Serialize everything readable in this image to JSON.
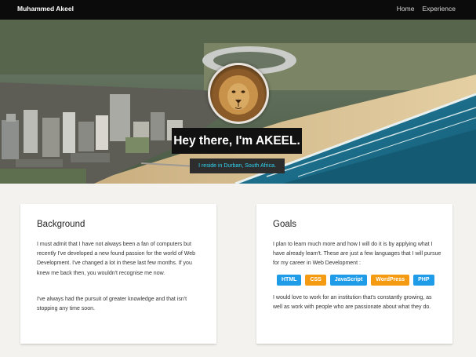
{
  "navbar": {
    "brand": "Muhammed Akeel",
    "links": [
      "Home",
      "Experience"
    ]
  },
  "hero": {
    "headline": "Hey there, I'm AKEEL.",
    "subline": "I reside in Durban, South Africa."
  },
  "background_card": {
    "title": "Background",
    "paragraph_1": "I must admit that I have not always been a fan of computers but recently I've developed a new found passion for the world of Web Development. I've changed a lot in these last few months. If you knew me back then, you wouldn't recognise me now.",
    "paragraph_2": "I've always had the pursuit of greater knowledge and that isn't stopping any time soon."
  },
  "goals_card": {
    "title": "Goals",
    "paragraph_1": "I plan to learn much more and how I will do it is by applying what I have already learn't. These are just a few languages that I will pursue for my career in Web Development :",
    "tags": [
      {
        "label": "HTML",
        "color": "#1e9ce8"
      },
      {
        "label": "CSS",
        "color": "#f59b11"
      },
      {
        "label": "JavaScript",
        "color": "#1e9ce8"
      },
      {
        "label": "WordPress",
        "color": "#f59b11"
      },
      {
        "label": "PHP",
        "color": "#1e9ce8"
      }
    ],
    "paragraph_2": "I would love to work for an institution that's constantly growing, as well as work with people who are passionate about what they do."
  },
  "colors": {
    "navbar_bg": "#0b0b0b",
    "subline_text": "#2fd7f3",
    "page_bg": "#f3f2ef"
  }
}
